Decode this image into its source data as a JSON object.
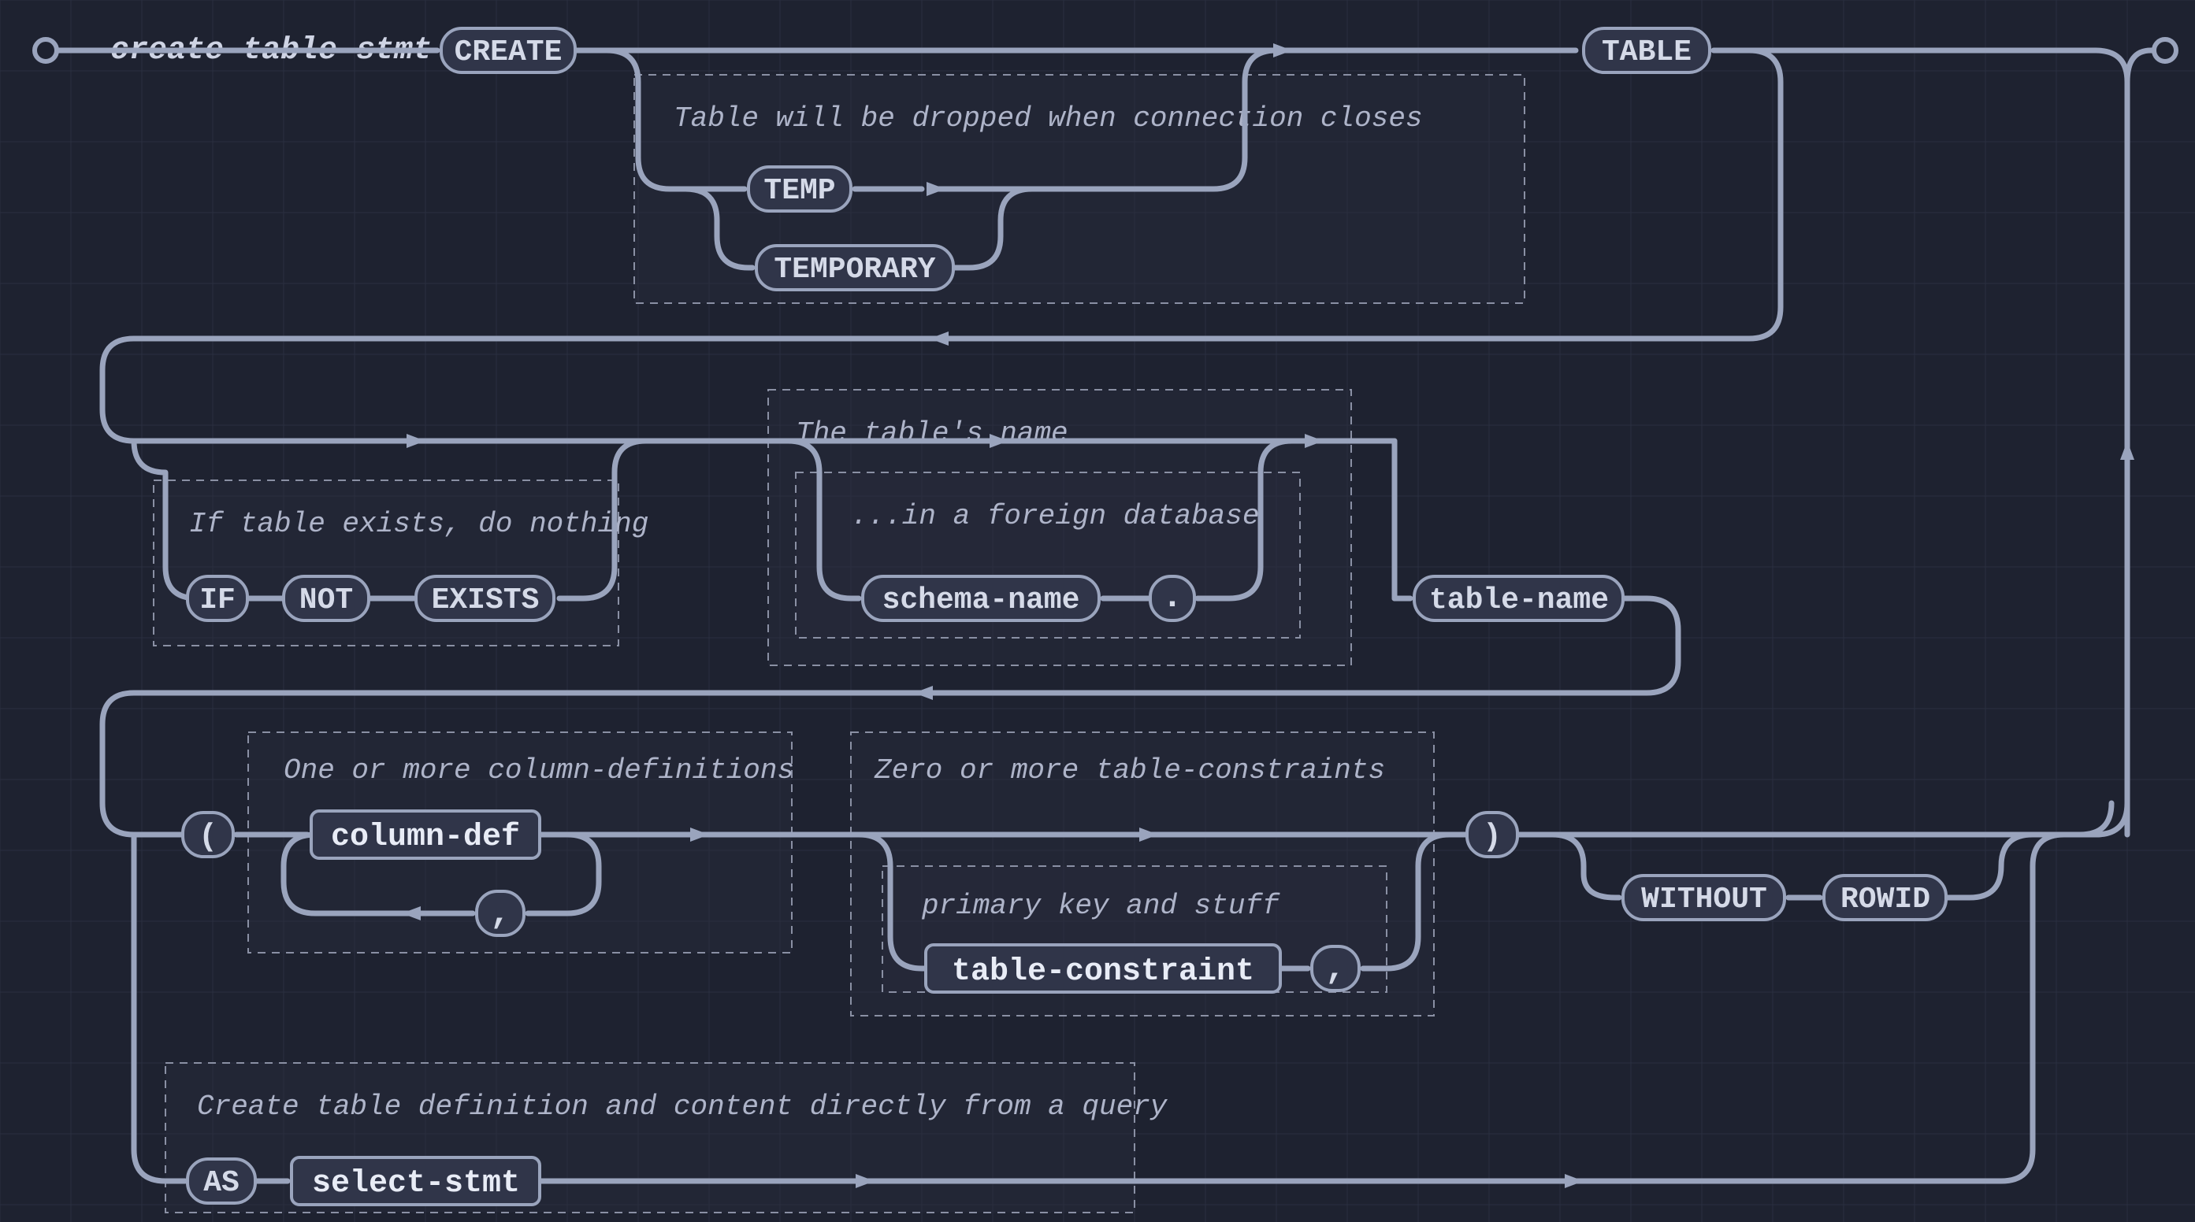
{
  "diagram": {
    "title": "create-table-stmt",
    "keywords": {
      "create": "CREATE",
      "table": "TABLE",
      "temp": "TEMP",
      "temporary": "TEMPORARY",
      "if": "IF",
      "not": "NOT",
      "exists": "EXISTS",
      "schema_name": "schema-name",
      "dot": ".",
      "table_name": "table-name",
      "lparen": "(",
      "rparen": ")",
      "comma1": ",",
      "comma2": ",",
      "column_def": "column-def",
      "table_constraint": "table-constraint",
      "without": "WITHOUT",
      "rowid": "ROWID",
      "as": "AS",
      "select_stmt": "select-stmt"
    },
    "comments": {
      "temp_box": "Table will be dropped when connection closes",
      "name_box": "The table's name",
      "schema_box": "...in a foreign database",
      "ifexists_box": "If table exists, do nothing",
      "coldef_box": "One or more column-definitions",
      "tconstraint_outer": "Zero or more table-constraints",
      "tconstraint_inner": "primary key and stuff",
      "as_box": "Create table definition and content directly from a query"
    }
  }
}
